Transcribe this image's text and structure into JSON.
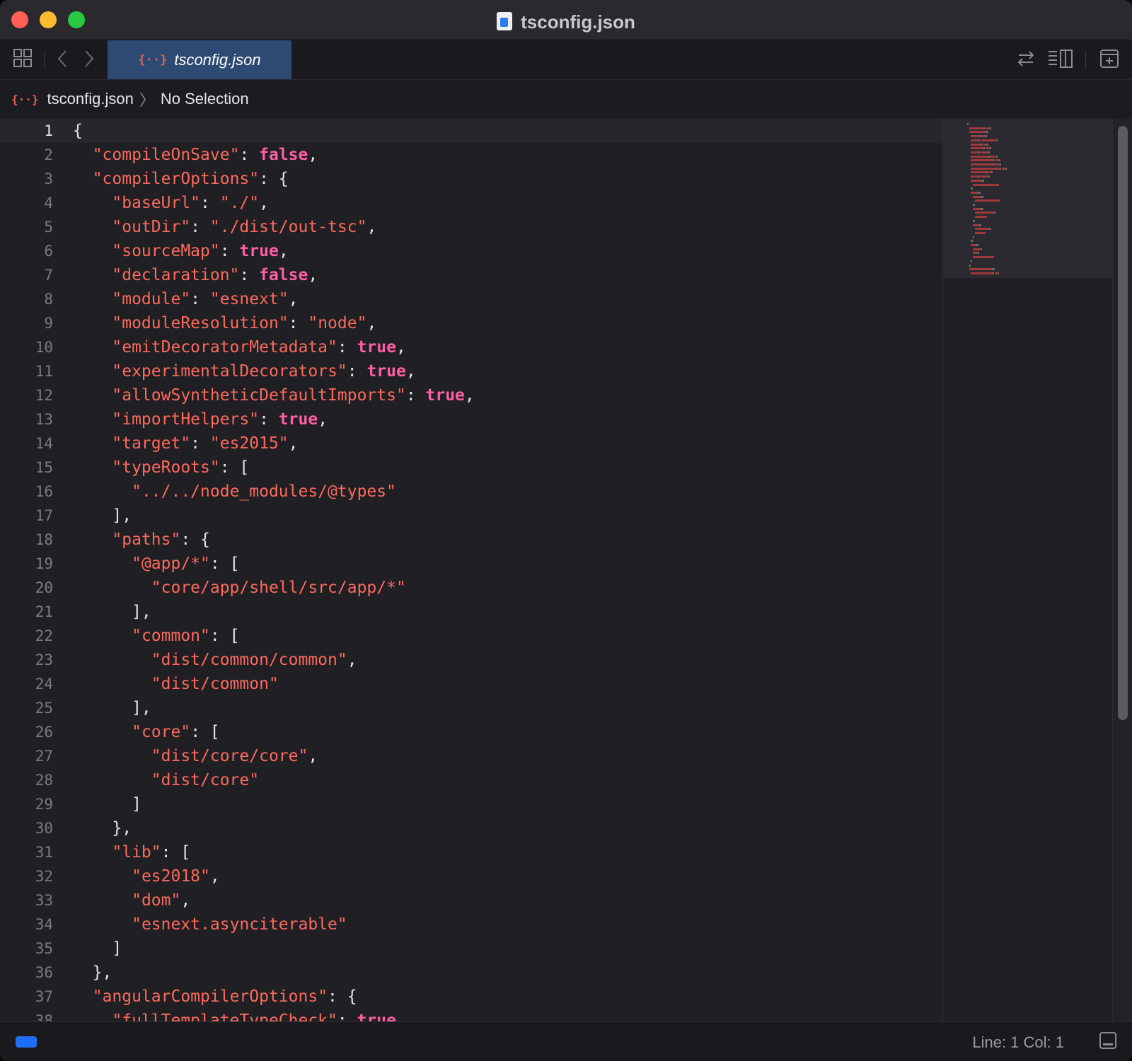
{
  "window": {
    "title": "tsconfig.json"
  },
  "tab": {
    "label": "tsconfig.json",
    "icon": "{··}"
  },
  "breadcrumb": {
    "file": "tsconfig.json",
    "icon": "{··}",
    "selection": "No Selection"
  },
  "status": {
    "line_col": "Line: 1  Col: 1"
  },
  "current_line": 1,
  "lines": [
    [
      [
        "p",
        "{"
      ]
    ],
    [
      [
        "p",
        "  "
      ],
      [
        "k",
        "\"compileOnSave\""
      ],
      [
        "p",
        ": "
      ],
      [
        "b",
        "false"
      ],
      [
        "p",
        ","
      ]
    ],
    [
      [
        "p",
        "  "
      ],
      [
        "k",
        "\"compilerOptions\""
      ],
      [
        "p",
        ": {"
      ]
    ],
    [
      [
        "p",
        "    "
      ],
      [
        "k",
        "\"baseUrl\""
      ],
      [
        "p",
        ": "
      ],
      [
        "s",
        "\"./\""
      ],
      [
        "p",
        ","
      ]
    ],
    [
      [
        "p",
        "    "
      ],
      [
        "k",
        "\"outDir\""
      ],
      [
        "p",
        ": "
      ],
      [
        "s",
        "\"./dist/out-tsc\""
      ],
      [
        "p",
        ","
      ]
    ],
    [
      [
        "p",
        "    "
      ],
      [
        "k",
        "\"sourceMap\""
      ],
      [
        "p",
        ": "
      ],
      [
        "b",
        "true"
      ],
      [
        "p",
        ","
      ]
    ],
    [
      [
        "p",
        "    "
      ],
      [
        "k",
        "\"declaration\""
      ],
      [
        "p",
        ": "
      ],
      [
        "b",
        "false"
      ],
      [
        "p",
        ","
      ]
    ],
    [
      [
        "p",
        "    "
      ],
      [
        "k",
        "\"module\""
      ],
      [
        "p",
        ": "
      ],
      [
        "s",
        "\"esnext\""
      ],
      [
        "p",
        ","
      ]
    ],
    [
      [
        "p",
        "    "
      ],
      [
        "k",
        "\"moduleResolution\""
      ],
      [
        "p",
        ": "
      ],
      [
        "s",
        "\"node\""
      ],
      [
        "p",
        ","
      ]
    ],
    [
      [
        "p",
        "    "
      ],
      [
        "k",
        "\"emitDecoratorMetadata\""
      ],
      [
        "p",
        ": "
      ],
      [
        "b",
        "true"
      ],
      [
        "p",
        ","
      ]
    ],
    [
      [
        "p",
        "    "
      ],
      [
        "k",
        "\"experimentalDecorators\""
      ],
      [
        "p",
        ": "
      ],
      [
        "b",
        "true"
      ],
      [
        "p",
        ","
      ]
    ],
    [
      [
        "p",
        "    "
      ],
      [
        "k",
        "\"allowSyntheticDefaultImports\""
      ],
      [
        "p",
        ": "
      ],
      [
        "b",
        "true"
      ],
      [
        "p",
        ","
      ]
    ],
    [
      [
        "p",
        "    "
      ],
      [
        "k",
        "\"importHelpers\""
      ],
      [
        "p",
        ": "
      ],
      [
        "b",
        "true"
      ],
      [
        "p",
        ","
      ]
    ],
    [
      [
        "p",
        "    "
      ],
      [
        "k",
        "\"target\""
      ],
      [
        "p",
        ": "
      ],
      [
        "s",
        "\"es2015\""
      ],
      [
        "p",
        ","
      ]
    ],
    [
      [
        "p",
        "    "
      ],
      [
        "k",
        "\"typeRoots\""
      ],
      [
        "p",
        ": ["
      ]
    ],
    [
      [
        "p",
        "      "
      ],
      [
        "s",
        "\"../../node_modules/@types\""
      ]
    ],
    [
      [
        "p",
        "    ],"
      ]
    ],
    [
      [
        "p",
        "    "
      ],
      [
        "k",
        "\"paths\""
      ],
      [
        "p",
        ": {"
      ]
    ],
    [
      [
        "p",
        "      "
      ],
      [
        "k",
        "\"@app/*\""
      ],
      [
        "p",
        ": ["
      ]
    ],
    [
      [
        "p",
        "        "
      ],
      [
        "s",
        "\"core/app/shell/src/app/*\""
      ]
    ],
    [
      [
        "p",
        "      ],"
      ]
    ],
    [
      [
        "p",
        "      "
      ],
      [
        "k",
        "\"common\""
      ],
      [
        "p",
        ": ["
      ]
    ],
    [
      [
        "p",
        "        "
      ],
      [
        "s",
        "\"dist/common/common\""
      ],
      [
        "p",
        ","
      ]
    ],
    [
      [
        "p",
        "        "
      ],
      [
        "s",
        "\"dist/common\""
      ]
    ],
    [
      [
        "p",
        "      ],"
      ]
    ],
    [
      [
        "p",
        "      "
      ],
      [
        "k",
        "\"core\""
      ],
      [
        "p",
        ": ["
      ]
    ],
    [
      [
        "p",
        "        "
      ],
      [
        "s",
        "\"dist/core/core\""
      ],
      [
        "p",
        ","
      ]
    ],
    [
      [
        "p",
        "        "
      ],
      [
        "s",
        "\"dist/core\""
      ]
    ],
    [
      [
        "p",
        "      ]"
      ]
    ],
    [
      [
        "p",
        "    },"
      ]
    ],
    [
      [
        "p",
        "    "
      ],
      [
        "k",
        "\"lib\""
      ],
      [
        "p",
        ": ["
      ]
    ],
    [
      [
        "p",
        "      "
      ],
      [
        "s",
        "\"es2018\""
      ],
      [
        "p",
        ","
      ]
    ],
    [
      [
        "p",
        "      "
      ],
      [
        "s",
        "\"dom\""
      ],
      [
        "p",
        ","
      ]
    ],
    [
      [
        "p",
        "      "
      ],
      [
        "s",
        "\"esnext.asynciterable\""
      ]
    ],
    [
      [
        "p",
        "    ]"
      ]
    ],
    [
      [
        "p",
        "  },"
      ]
    ],
    [
      [
        "p",
        "  "
      ],
      [
        "k",
        "\"angularCompilerOptions\""
      ],
      [
        "p",
        ": {"
      ]
    ],
    [
      [
        "p",
        "    "
      ],
      [
        "k",
        "\"fullTemplateTypeCheck\""
      ],
      [
        "p",
        ": "
      ],
      [
        "b",
        "true"
      ]
    ]
  ]
}
